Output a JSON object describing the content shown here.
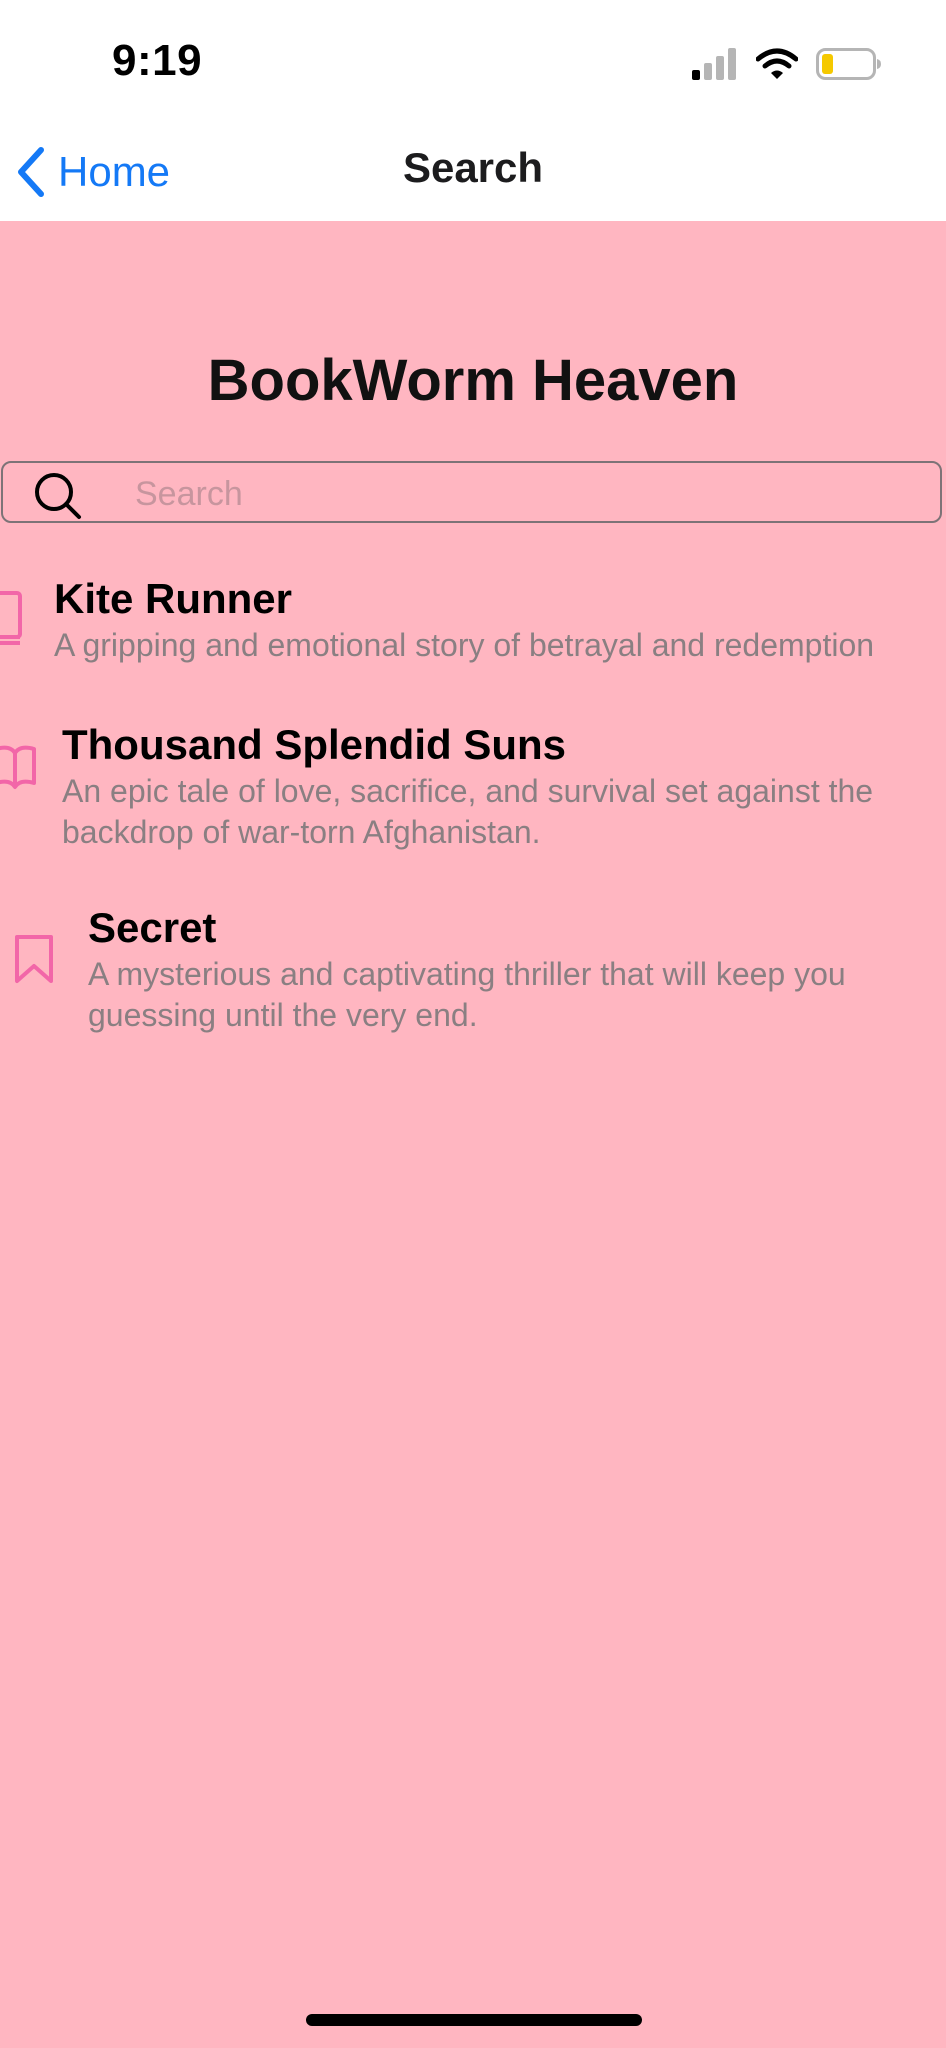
{
  "status_bar": {
    "time": "9:19"
  },
  "nav": {
    "back_label": "Home",
    "title": "Search"
  },
  "app": {
    "title": "BookWorm Heaven"
  },
  "search": {
    "placeholder": "Search",
    "value": ""
  },
  "books": [
    {
      "title": "Kite Runner",
      "description": "A gripping and emotional story of betrayal and redemption",
      "icon": "book-closed-icon"
    },
    {
      "title": "Thousand Splendid Suns",
      "description": "An epic tale of love, sacrifice, and survival set against the\nbackdrop of war-torn Afghanistan.",
      "icon": "book-open-icon"
    },
    {
      "title": "Secret",
      "description": "A mysterious and captivating thriller that will keep you\nguessing until the very end.",
      "icon": "bookmark-icon"
    }
  ],
  "colors": {
    "background": "#FFB6C1",
    "accent": "#1479F6",
    "icon_pink": "#F266A8"
  }
}
